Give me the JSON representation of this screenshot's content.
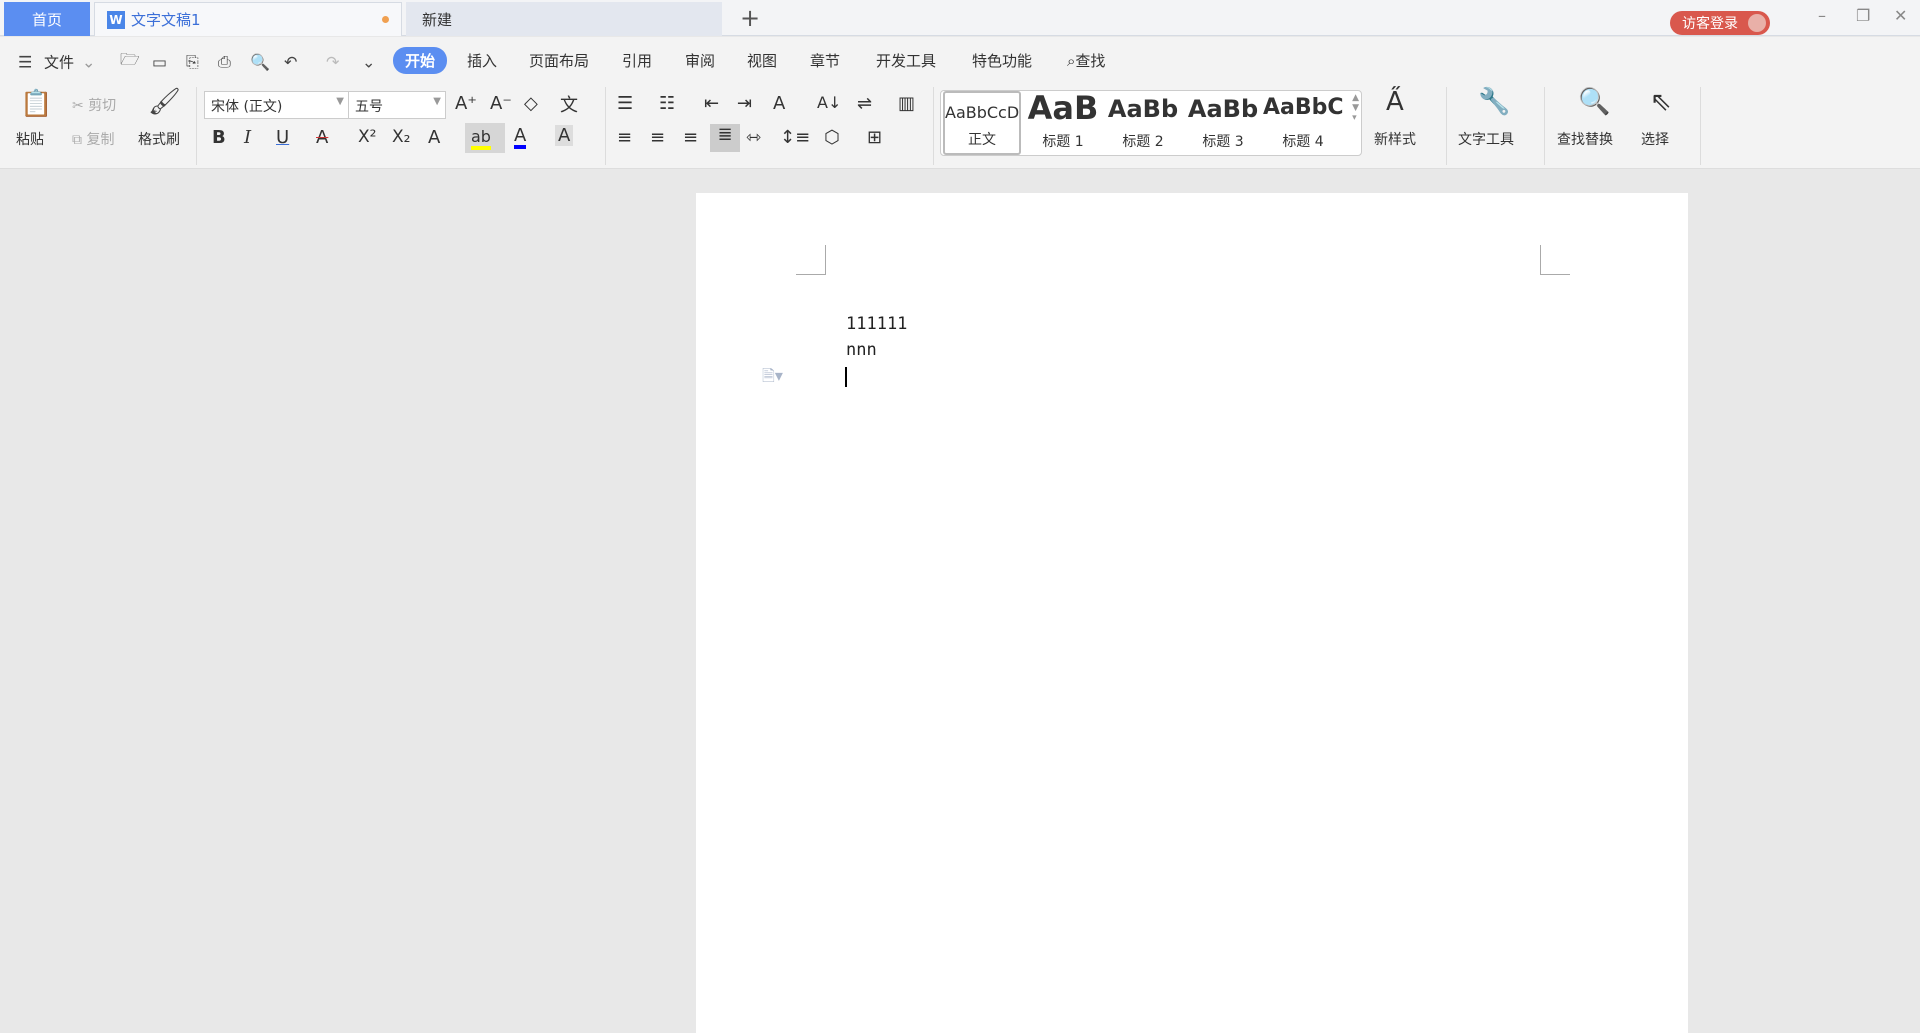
{
  "tabs": {
    "home": "首页",
    "doc": "文字文稿1",
    "doc_icon": "W",
    "new": "新建",
    "add": "+"
  },
  "window": {
    "login": "访客登录",
    "minimize": "–",
    "restore": "❐",
    "close": "✕"
  },
  "toolbar": {
    "file": "文件",
    "tabs": [
      "开始",
      "插入",
      "页面布局",
      "引用",
      "审阅",
      "视图",
      "章节",
      "开发工具",
      "特色功能"
    ],
    "find": "查找"
  },
  "ribbon": {
    "paste": "粘贴",
    "cut": "剪切",
    "copy": "复制",
    "format_painter": "格式刷",
    "font": "宋体 (正文)",
    "size": "五号",
    "styles": [
      {
        "preview": "AaBbCcDd",
        "label": "正文"
      },
      {
        "preview": "AaB",
        "label": "标题 1"
      },
      {
        "preview": "AaBb",
        "label": "标题 2"
      },
      {
        "preview": "AaBb",
        "label": "标题 3"
      },
      {
        "preview": "AaBbC",
        "label": "标题 4"
      }
    ],
    "new_style": "新样式",
    "text_tools": "文字工具",
    "find_replace": "查找替换",
    "select": "选择"
  },
  "document": {
    "lines": [
      "111111",
      "nnn"
    ]
  },
  "colors": {
    "accent": "#5b8ef1",
    "login": "#d9584d",
    "highlight": "#ffff00",
    "font_color": "#0000ff"
  }
}
